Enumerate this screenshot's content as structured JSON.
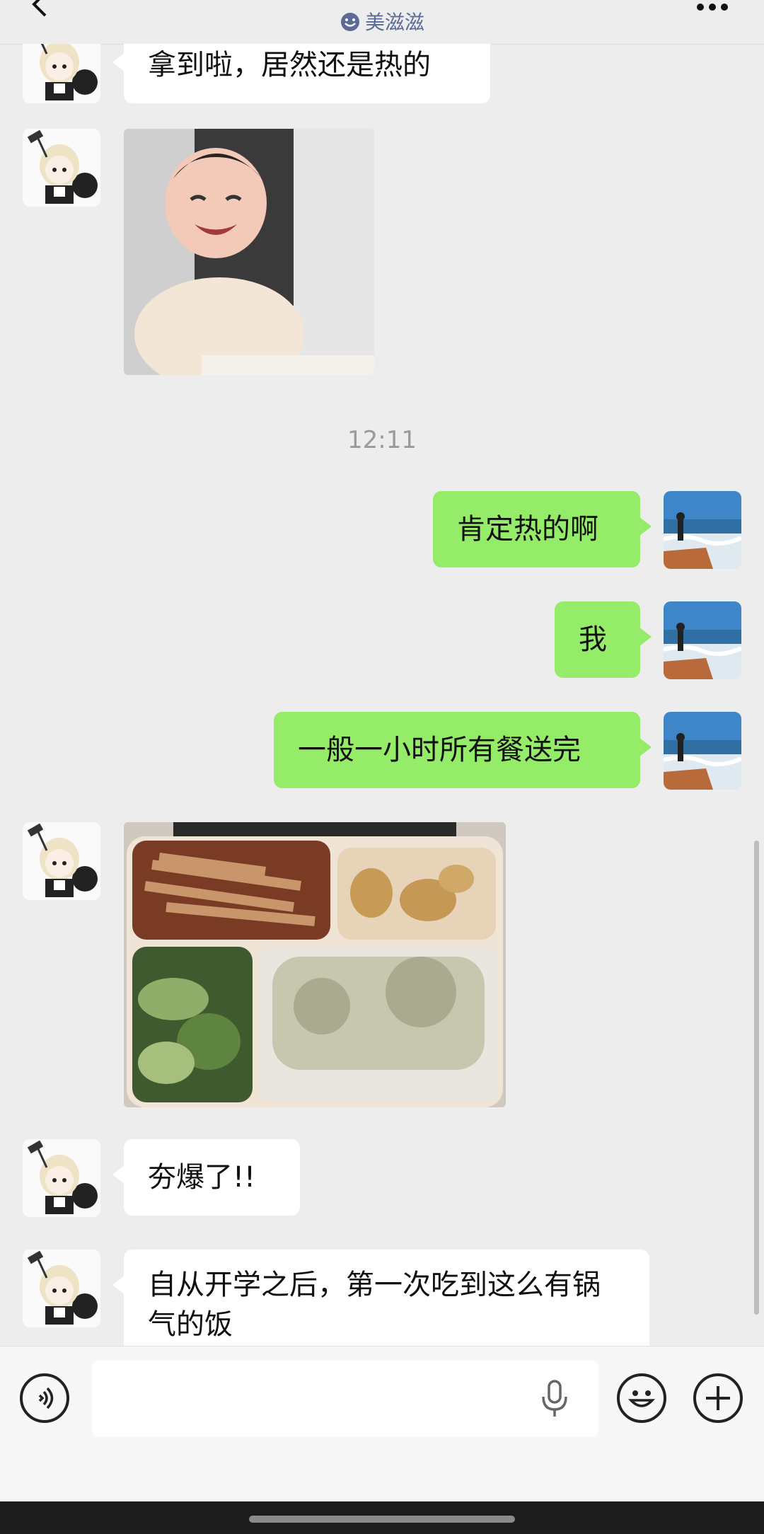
{
  "header": {
    "title": "",
    "subtitle": "美滋滋"
  },
  "messages": [
    {
      "from": "them",
      "type": "text",
      "text": "拿到啦，居然还是热的"
    },
    {
      "from": "them",
      "type": "image",
      "content": "baby-sticker"
    },
    {
      "type": "time",
      "text": "12:11"
    },
    {
      "from": "me",
      "type": "text",
      "text": "肯定热的啊"
    },
    {
      "from": "me",
      "type": "text",
      "text": "我"
    },
    {
      "from": "me",
      "type": "text",
      "text": "一般一小时所有餐送完"
    },
    {
      "from": "them",
      "type": "image",
      "content": "meal-box-photo"
    },
    {
      "from": "them",
      "type": "text",
      "text": "夯爆了!!"
    },
    {
      "from": "them",
      "type": "text",
      "text": "自从开学之后，第一次吃到这么有锅气的饭"
    }
  ],
  "input_bar": {
    "value": "",
    "icons": [
      "voice-icon",
      "mic-icon",
      "emoji-icon",
      "plus-icon"
    ]
  },
  "colors": {
    "background": "#ededed",
    "outgoing_bubble": "#95ec69",
    "incoming_bubble": "#ffffff",
    "subtitle": "#5b6b96"
  }
}
